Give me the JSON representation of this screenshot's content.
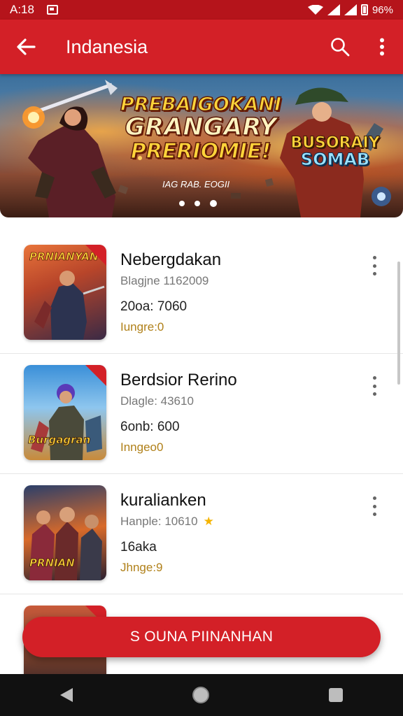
{
  "status_bar": {
    "time": "A:18",
    "battery": "96%"
  },
  "app_bar": {
    "title": "Indanesia",
    "back_icon": "arrow-left-icon",
    "search_icon": "search-icon",
    "more_icon": "more-vertical-icon"
  },
  "banner": {
    "headline_line1": "PREBAIGOKANI",
    "headline_line2": "GRANGARY",
    "headline_line3": "PRERIOMIE!",
    "subtext": "IAG RAB. EOGII",
    "badge_line1": "BUSORAIY",
    "badge_line2": "SOMAB",
    "slide_count": 3,
    "active_slide": 3
  },
  "games": [
    {
      "title": "Nebergdakan",
      "meta": "Blagjne 1162009",
      "stat": "20oa: 7060",
      "tag": "Iungre:0",
      "thumb_label": "PRNIANYAN",
      "has_star": false
    },
    {
      "title": "Berdsior Rerino",
      "meta": "Dlagle: 43610",
      "stat": "6onb: 600",
      "tag": "Inngeo0",
      "thumb_label": "Burgagran",
      "has_star": false
    },
    {
      "title": "kuralianken",
      "meta": "Hanple: 10610",
      "stat": "16aka",
      "tag": "Jhnge:9",
      "thumb_label": "PRNIAN",
      "has_star": true
    },
    {
      "title": "",
      "meta": "",
      "stat": "",
      "tag": "",
      "thumb_label": "",
      "has_star": false
    }
  ],
  "cta": {
    "label": "S OUNA PIINANHAN"
  },
  "colors": {
    "primary": "#d32027",
    "status_bar": "#b5141b",
    "tag_gold": "#b08019",
    "star": "#f5b400"
  }
}
